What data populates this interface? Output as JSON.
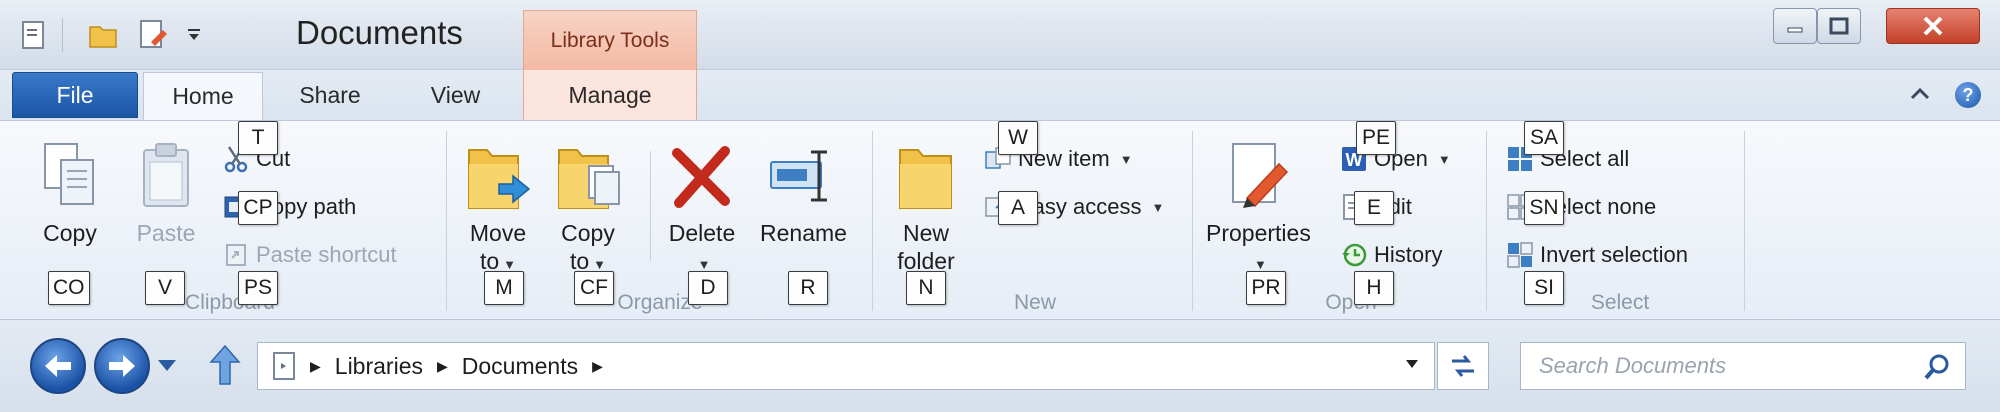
{
  "window": {
    "title": "Documents",
    "contextual_tab_header": "Library Tools"
  },
  "quick_access": {
    "icons": [
      "properties-icon",
      "new-folder-icon",
      "edit-icon",
      "customize-dropdown-icon"
    ]
  },
  "tabs": [
    {
      "label": "File",
      "active": false
    },
    {
      "label": "Home",
      "active": true
    },
    {
      "label": "Share",
      "active": false
    },
    {
      "label": "View",
      "active": false
    },
    {
      "label": "Manage",
      "active": false
    }
  ],
  "ribbon": {
    "clipboard": {
      "label": "Clipboard",
      "copy": "Copy",
      "paste": "Paste",
      "cut": "Cut",
      "copy_path": "Copy path",
      "paste_shortcut": "Paste shortcut"
    },
    "organize": {
      "label": "Organize",
      "move_to_1": "Move",
      "move_to_2": "to",
      "copy_to_1": "Copy",
      "copy_to_2": "to",
      "delete": "Delete",
      "rename": "Rename"
    },
    "new": {
      "label": "New",
      "new_folder_1": "New",
      "new_folder_2": "folder",
      "new_item": "New item",
      "easy_access": "Easy access"
    },
    "open": {
      "label": "Open",
      "properties": "Properties",
      "open": "Open",
      "edit": "Edit",
      "history": "History"
    },
    "select": {
      "label": "Select",
      "select_all": "Select all",
      "select_none": "Select none",
      "invert_selection": "Invert selection"
    }
  },
  "keytips": {
    "cut": "T",
    "copy_path": "CP",
    "copy": "CO",
    "paste": "V",
    "paste_shortcut": "PS",
    "move_to": "M",
    "copy_to": "CF",
    "delete": "D",
    "rename": "R",
    "new_item": "W",
    "easy_access": "A",
    "new_folder": "N",
    "open": "PE",
    "edit": "E",
    "history": "H",
    "properties": "PR",
    "select_all": "SA",
    "select_none": "SN",
    "invert_selection": "SI"
  },
  "address_bar": {
    "breadcrumbs": [
      "Libraries",
      "Documents"
    ]
  },
  "search": {
    "placeholder": "Search Documents"
  },
  "colors": {
    "file_tab": "#1b56a5",
    "contextual_tab": "#f3b9a5",
    "close_button": "#c4402a",
    "accent_blue": "#1a52a6"
  }
}
